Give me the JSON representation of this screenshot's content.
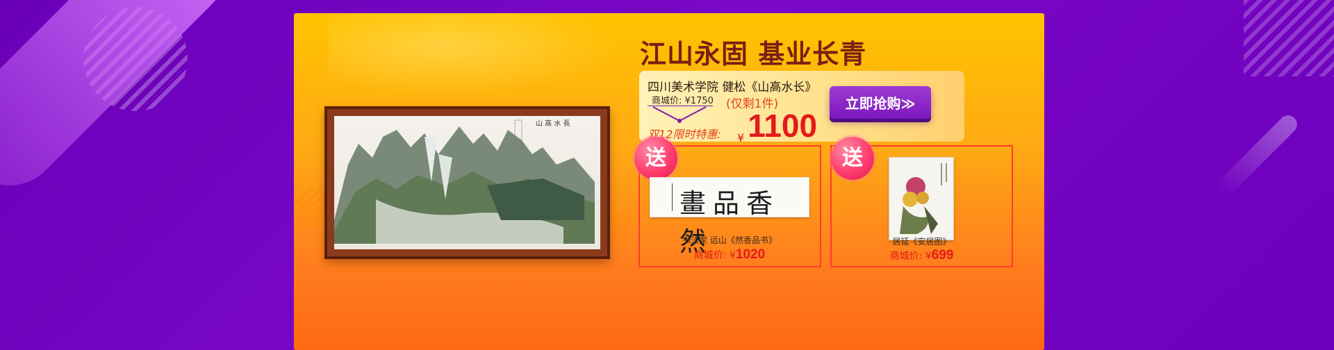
{
  "banner": {
    "title": "江山永固 基业长青"
  },
  "offer": {
    "product_name": "四川美术学院 健松《山高水长》",
    "mall_price_label": "商城价:",
    "mall_price_value": "¥1750",
    "remaining": "(仅剩1件)",
    "promo_label": "双12限时特惠:",
    "price_currency": "¥",
    "price_value": "1100",
    "buy_button": "立即抢购≫"
  },
  "painting": {
    "inscription": "山高水长"
  },
  "gifts": [
    {
      "badge": "送",
      "calligraphy_text": "畫品香然",
      "name": "书法家 远山《然香品书》",
      "price_label": "商城价:",
      "price_currency": "¥",
      "price_value": "1020"
    },
    {
      "badge": "送",
      "name": "居延《安居图》",
      "price_label": "商城价:",
      "price_currency": "¥",
      "price_value": "699"
    }
  ],
  "colors": {
    "bg_purple": "#7a08c6",
    "panel_orange": "#ffaa14",
    "title_brown": "#7a1f10",
    "price_red": "#e31a1a",
    "button_purple": "#8a20c8"
  }
}
